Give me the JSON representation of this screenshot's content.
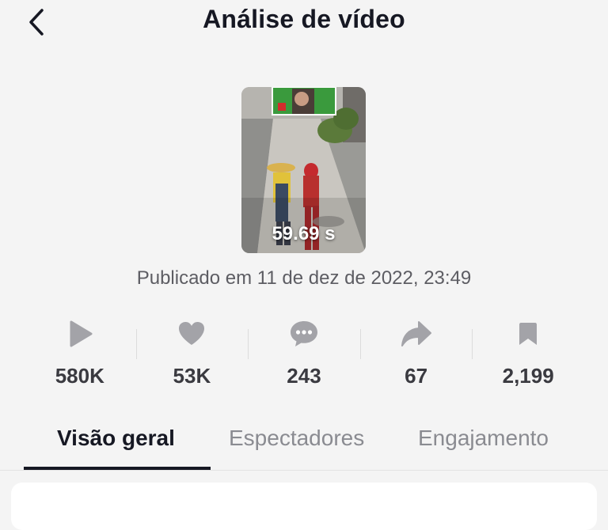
{
  "header": {
    "title": "Análise de vídeo",
    "back_icon": "chevron-left-icon"
  },
  "video": {
    "duration": "59.69 s",
    "published": "Publicado em 11 de dez de 2022, 23:49"
  },
  "stats": [
    {
      "icon": "play-icon",
      "value": "580K"
    },
    {
      "icon": "heart-icon",
      "value": "53K"
    },
    {
      "icon": "comment-icon",
      "value": "243"
    },
    {
      "icon": "share-icon",
      "value": "67"
    },
    {
      "icon": "bookmark-icon",
      "value": "2,199"
    }
  ],
  "tabs": [
    {
      "label": "Visão geral",
      "active": true
    },
    {
      "label": "Espectadores",
      "active": false
    },
    {
      "label": "Engajamento",
      "active": false
    }
  ],
  "colors": {
    "background": "#f4f4f4",
    "text_primary": "#161823",
    "text_secondary": "#8a8b91",
    "icon_gray": "#a3a3a8"
  }
}
